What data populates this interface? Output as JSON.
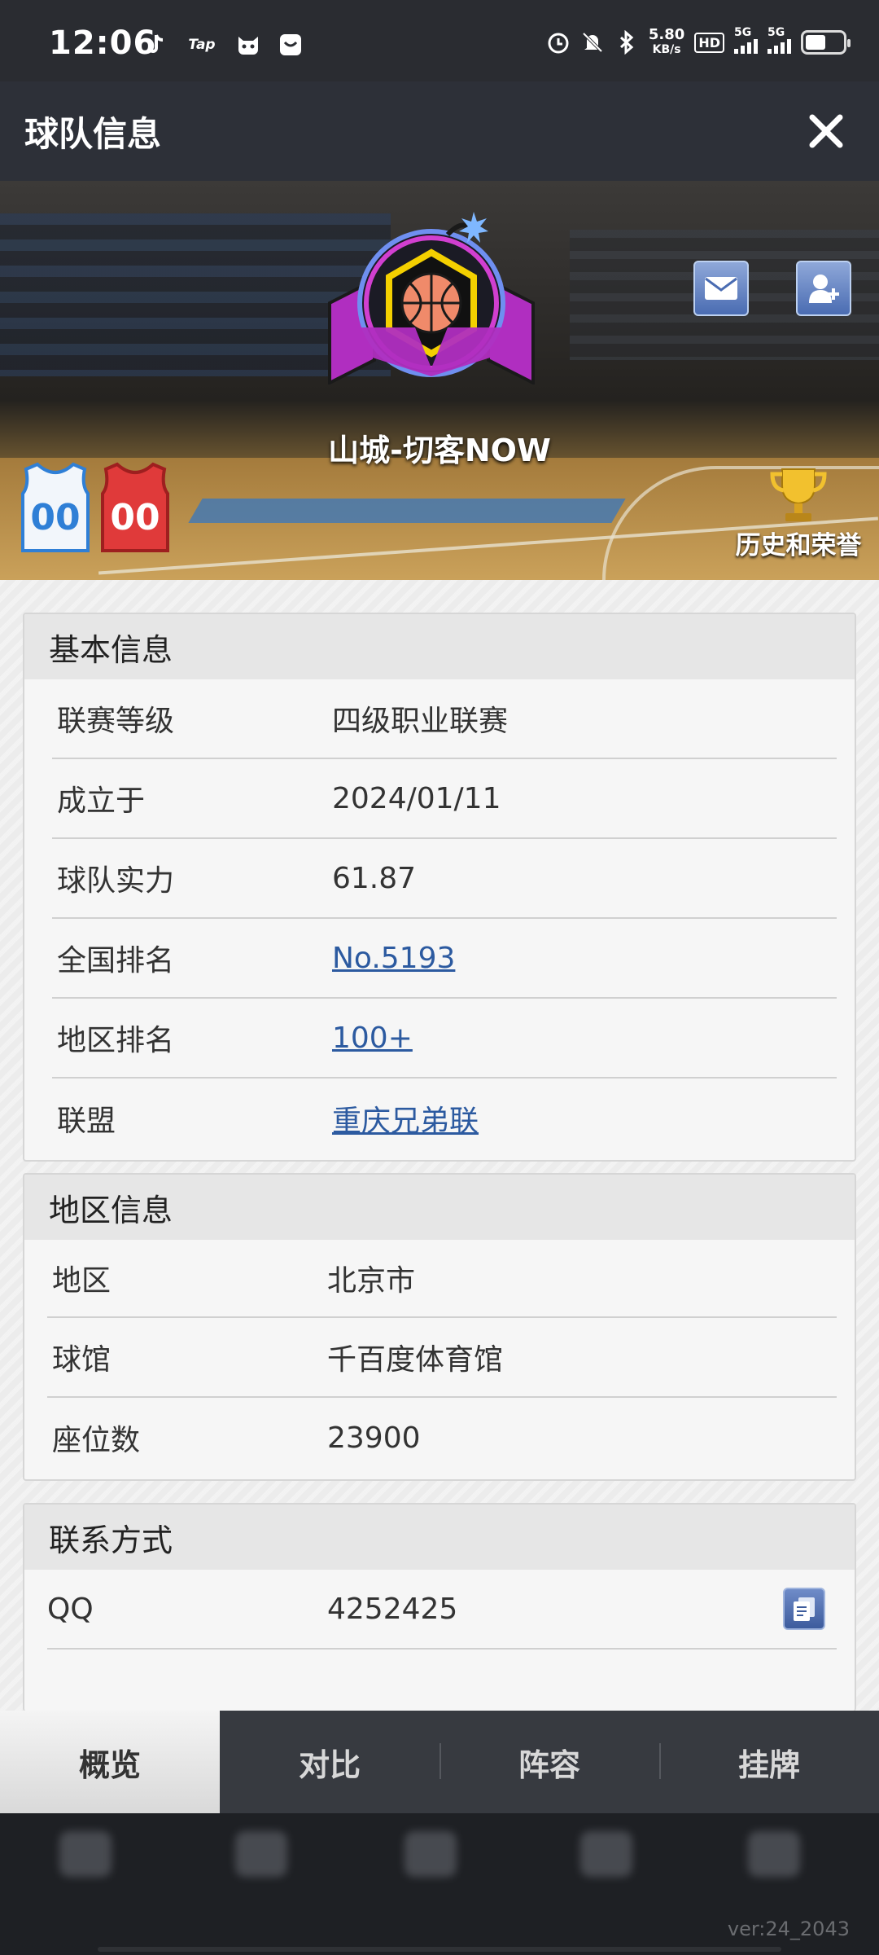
{
  "status_bar": {
    "time": "12:06",
    "net_speed_value": "5.80",
    "net_speed_unit": "KB/s",
    "hd_label": "HD",
    "sim1_tag": "5G",
    "sim2_tag": "5G",
    "tap_label": "Tap"
  },
  "header": {
    "title": "球队信息"
  },
  "hero": {
    "team_name": "山城-切客NOW",
    "home_jersey_number": "00",
    "away_jersey_number": "00",
    "honors_label": "历史和荣誉"
  },
  "basic_info": {
    "title": "基本信息",
    "rows": [
      {
        "label": "联赛等级",
        "value": "四级职业联赛"
      },
      {
        "label": "成立于",
        "value": "2024/01/11"
      },
      {
        "label": "球队实力",
        "value": "61.87"
      },
      {
        "label": "全国排名",
        "value": "No.5193"
      },
      {
        "label": "地区排名",
        "value": "100+"
      },
      {
        "label": "联盟",
        "value": "重庆兄弟联"
      }
    ]
  },
  "region_info": {
    "title": "地区信息",
    "rows": [
      {
        "label": "地区",
        "value": "北京市"
      },
      {
        "label": "球馆",
        "value": "千百度体育馆"
      },
      {
        "label": "座位数",
        "value": "23900"
      }
    ]
  },
  "contact": {
    "title": "联系方式",
    "rows": [
      {
        "label": "QQ",
        "value": "4252425"
      }
    ]
  },
  "tabs": [
    {
      "label": "概览",
      "active": true
    },
    {
      "label": "对比",
      "active": false
    },
    {
      "label": "阵容",
      "active": false
    },
    {
      "label": "挂牌",
      "active": false
    }
  ],
  "version": "ver:24_2043",
  "colors": {
    "link": "#2c5aa0",
    "logo_magenta": "#b02ec0",
    "logo_yellow": "#f4d000",
    "jersey_blue": "#2f7fd6",
    "jersey_red": "#e03a3a"
  }
}
